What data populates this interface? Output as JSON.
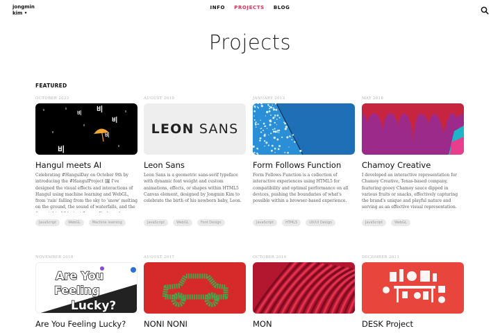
{
  "brand": {
    "line1": "jongmin",
    "line2": "kim •"
  },
  "nav": [
    {
      "label": "INFO",
      "active": false
    },
    {
      "label": "PROJECTS",
      "active": true
    },
    {
      "label": "BLOG",
      "active": false
    }
  ],
  "page": {
    "title": "Projects"
  },
  "featured": {
    "label": "FEATURED"
  },
  "colors": {
    "accent": "#e8305a"
  },
  "projects": [
    {
      "date": "OCTOBER 2023",
      "title": "Hangul meets AI",
      "description": "Celebrating #HangulDay on October 9th by introducing the #HangulProject 🖼 I've designed the visual effects and interactions of Hangul using machine learning and WebGL, from 'rain' falling from the sky to 'snow' melting on the ground, the sound of waterfalls, and the fiery sight of 'blazing' flames. Each work highlights the uniqueness and creativity of Hangul.",
      "tags": [
        "JavaScript",
        "WebGL",
        "Machine learning"
      ],
      "thumb_text": [
        "비",
        "비",
        "비",
        "비",
        "비"
      ]
    },
    {
      "date": "AUGUST 2019",
      "title": "Leon Sans",
      "description": "Leon Sans is a geometric sans-serif typeface with dynamic font weight and custom animations, effects, or shapes within HTML5 Canvas element, designed by Jongmin Kim to celebrate the birth of his newborn baby, Leon.",
      "tags": [
        "JavaScript",
        "WebGL",
        "Font Design"
      ],
      "thumb_text": [
        "LEON",
        "SANS"
      ]
    },
    {
      "date": "JANUARY 2013",
      "title": "Form Follows Function",
      "description": "Form Follows Function is a collection of interactive experiences using HTML5 for compatibility and optimal performance on all devices, pushing the boundaries of what's possible within a browser-based experience.",
      "tags": [
        "JavaScript",
        "HTML5",
        "UX/UI Design"
      ]
    },
    {
      "date": "MAY 2018",
      "title": "Chamoy Creative",
      "description": "I developed an interactive representation for Chamoy Creative, Texas-based company, featuring gooey Chamoy sauce dipped in various fruits or snacks, effectively capturing the brand's unique and playful nature and serving as an effective visual representation.",
      "tags": [
        "JavaScript",
        "WebGL"
      ]
    },
    {
      "date": "NOVEMBER 2018",
      "title": "Are You Feeling Lucky?",
      "description": "",
      "tags": [],
      "thumb_text": [
        "Are You",
        "Feeling",
        "Lucky?"
      ]
    },
    {
      "date": "AUGUST 2017",
      "title": "NONI NONI",
      "description": "",
      "tags": []
    },
    {
      "date": "OCTOBER 2016",
      "title": "MON",
      "description": "",
      "tags": []
    },
    {
      "date": "DECEMBER 2011",
      "title": "DESK Project",
      "description": "",
      "tags": []
    }
  ]
}
